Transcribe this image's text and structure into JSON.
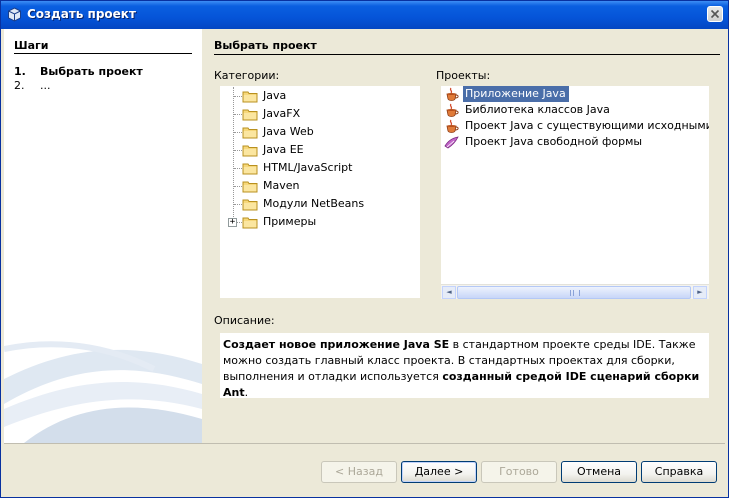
{
  "window": {
    "title": "Создать проект"
  },
  "steps": {
    "title": "Шаги",
    "items": [
      {
        "num": "1.",
        "label": "Выбрать проект"
      },
      {
        "num": "2.",
        "label": "..."
      }
    ]
  },
  "main": {
    "title": "Выбрать проект"
  },
  "categories": {
    "label": "Категории:",
    "items": [
      {
        "label": "Java"
      },
      {
        "label": "JavaFX"
      },
      {
        "label": "Java Web"
      },
      {
        "label": "Java EE"
      },
      {
        "label": "HTML/JavaScript"
      },
      {
        "label": "Maven"
      },
      {
        "label": "Модули NetBeans"
      },
      {
        "label": "Примеры",
        "expander": "+"
      }
    ]
  },
  "projects": {
    "label": "Проекты:",
    "selected_index": 0,
    "items": [
      {
        "label": "Приложение Java",
        "icon": "java-cup-icon"
      },
      {
        "label": "Библиотека классов Java",
        "icon": "java-cup-icon"
      },
      {
        "label": "Проект Java с существующими исходными файлами",
        "icon": "java-cup-icon"
      },
      {
        "label": "Проект Java свободной формы",
        "icon": "freeform-project-icon"
      }
    ],
    "scroll_left": "◄",
    "scroll_right": "►"
  },
  "description": {
    "label": "Описание:",
    "p1_b1": "Создает новое приложение Java SE",
    "p1_t1": " в стандартном проекте среды IDE. Также можно создать главный класс проекта. В стандартных проектах для сборки, выполнения и отладки используется ",
    "p1_b2": "созданный средой IDE сценарий сборки Ant",
    "p1_t2": "."
  },
  "buttons": {
    "back": "< Назад",
    "next": "Далее >",
    "finish": "Готово",
    "cancel": "Отмена",
    "help": "Справка"
  },
  "colors": {
    "selection": "#4a6ea9",
    "titlebar": "#0554d8"
  }
}
